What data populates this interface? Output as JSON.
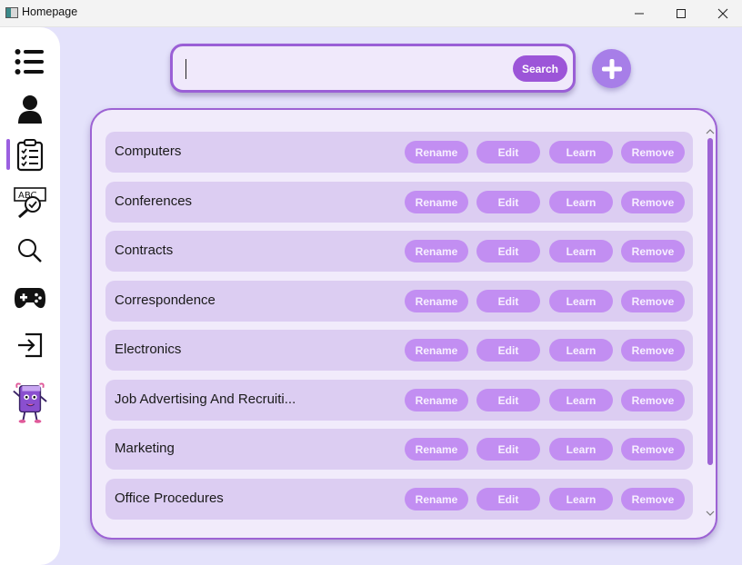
{
  "window": {
    "title": "Homepage",
    "minimize_icon": "minimize-icon",
    "maximize_icon": "maximize-icon",
    "close_icon": "close-icon"
  },
  "sidebar": {
    "items": [
      {
        "name": "menu",
        "icon": "list-icon"
      },
      {
        "name": "profile",
        "icon": "user-icon"
      },
      {
        "name": "lists",
        "icon": "clipboard-checklist-icon",
        "active": true
      },
      {
        "name": "spellcheck",
        "icon": "abc-check-magnifier-icon"
      },
      {
        "name": "search",
        "icon": "search-icon"
      },
      {
        "name": "games",
        "icon": "gamepad-icon"
      },
      {
        "name": "logout",
        "icon": "sign-in-icon"
      },
      {
        "name": "mascot",
        "icon": "book-mascot-icon"
      }
    ],
    "accent": "#9b5fe0"
  },
  "search": {
    "value": "",
    "placeholder": "",
    "button_label": "Search"
  },
  "add_button_icon": "plus-icon",
  "row_buttons": {
    "rename": "Rename",
    "edit": "Edit",
    "learn": "Learn",
    "remove": "Remove"
  },
  "categories": [
    {
      "label": "Computers"
    },
    {
      "label": "Conferences"
    },
    {
      "label": "Contracts"
    },
    {
      "label": "Correspondence"
    },
    {
      "label": "Electronics"
    },
    {
      "label": "Job Advertising And Recruiti..."
    },
    {
      "label": "Marketing"
    },
    {
      "label": "Office Procedures"
    }
  ],
  "colors": {
    "background": "#e4e2fb",
    "panel": "#f1ebfb",
    "row": "#dccdf2",
    "row_button": "#c28ef2",
    "search_button": "#9c55d8",
    "border": "#9d63d4"
  }
}
